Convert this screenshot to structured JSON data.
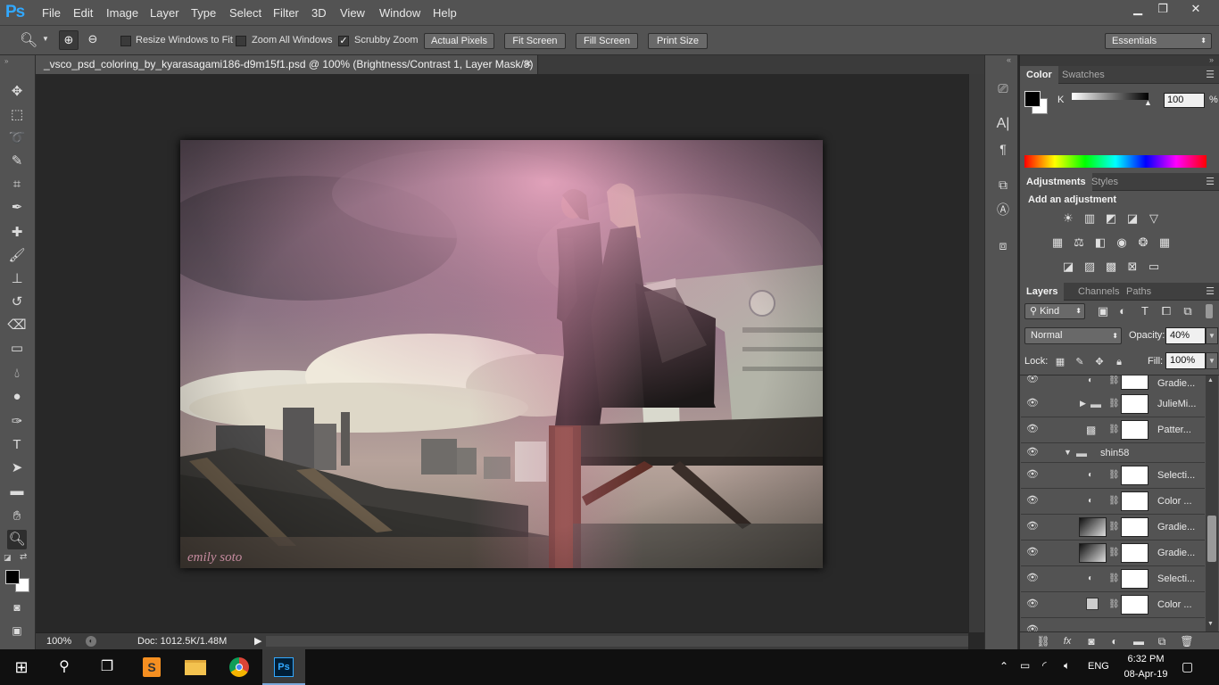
{
  "menubar": {
    "logo": "Ps",
    "items": [
      "File",
      "Edit",
      "Image",
      "Layer",
      "Type",
      "Select",
      "Filter",
      "3D",
      "View",
      "Window",
      "Help"
    ],
    "window_buttons": [
      "minimize-icon",
      "restore-icon",
      "close-icon"
    ]
  },
  "options": {
    "resize_windows": "Resize Windows to Fit",
    "zoom_all": "Zoom All Windows",
    "scrubby_zoom": "Scrubby Zoom",
    "actual_pixels": "Actual Pixels",
    "fit_screen": "Fit Screen",
    "fill_screen": "Fill Screen",
    "print_size": "Print Size",
    "workspace": "Essentials"
  },
  "document": {
    "tab_title": "_vsco_psd_coloring_by_kyarasagami186-d9m15f1.psd @ 100% (Brightness/Contrast 1, Layer Mask/8) *",
    "watermark": "emily soto"
  },
  "status": {
    "zoom": "100%",
    "doc_info": "Doc: 1012.5K/1.48M"
  },
  "color_panel": {
    "tabs": [
      "Color",
      "Swatches"
    ],
    "channel": "K",
    "value": "100",
    "unit": "%"
  },
  "adjustments_panel": {
    "tabs": [
      "Adjustments",
      "Styles"
    ],
    "title": "Add an adjustment"
  },
  "layers_panel": {
    "tabs": [
      "Layers",
      "Channels",
      "Paths"
    ],
    "filter": "Kind",
    "blend_mode": "Normal",
    "opacity_label": "Opacity:",
    "opacity": "40%",
    "lock_label": "Lock:",
    "fill_label": "Fill:",
    "fill": "100%",
    "layers": [
      {
        "name": "Gradie..."
      },
      {
        "name": "JulieMi..."
      },
      {
        "name": "Patter..."
      },
      {
        "name": "shin58"
      },
      {
        "name": "Selecti..."
      },
      {
        "name": "Color ..."
      },
      {
        "name": "Gradie..."
      },
      {
        "name": "Gradie..."
      },
      {
        "name": "Selecti..."
      },
      {
        "name": "Color ..."
      }
    ]
  },
  "taskbar": {
    "language": "ENG",
    "time": "6:32 PM",
    "date": "08-Apr-19"
  }
}
